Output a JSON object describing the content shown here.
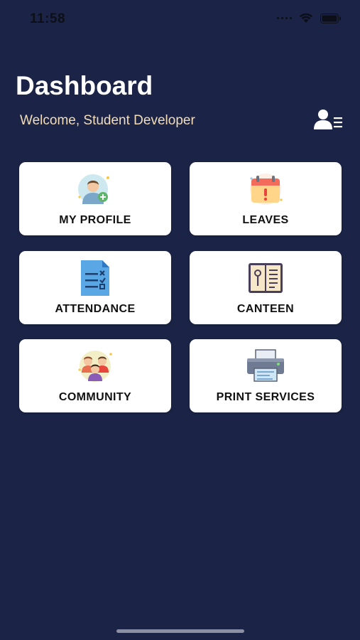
{
  "status_bar": {
    "time": "11:58",
    "icons": [
      "signal-icon",
      "wifi-icon",
      "battery-icon"
    ]
  },
  "header": {
    "title": "Dashboard",
    "welcome": "Welcome, Student Developer",
    "menu_icon": "user-menu-icon"
  },
  "tiles": [
    {
      "label": "MY PROFILE",
      "icon": "profile-icon"
    },
    {
      "label": "LEAVES",
      "icon": "calendar-icon"
    },
    {
      "label": "ATTENDANCE",
      "icon": "checklist-icon"
    },
    {
      "label": "CANTEEN",
      "icon": "menu-book-icon"
    },
    {
      "label": "COMMUNITY",
      "icon": "community-icon"
    },
    {
      "label": "PRINT SERVICES",
      "icon": "printer-icon"
    }
  ],
  "colors": {
    "background": "#1b2446",
    "tile_background": "#ffffff",
    "welcome_text": "#f3ddb8"
  }
}
